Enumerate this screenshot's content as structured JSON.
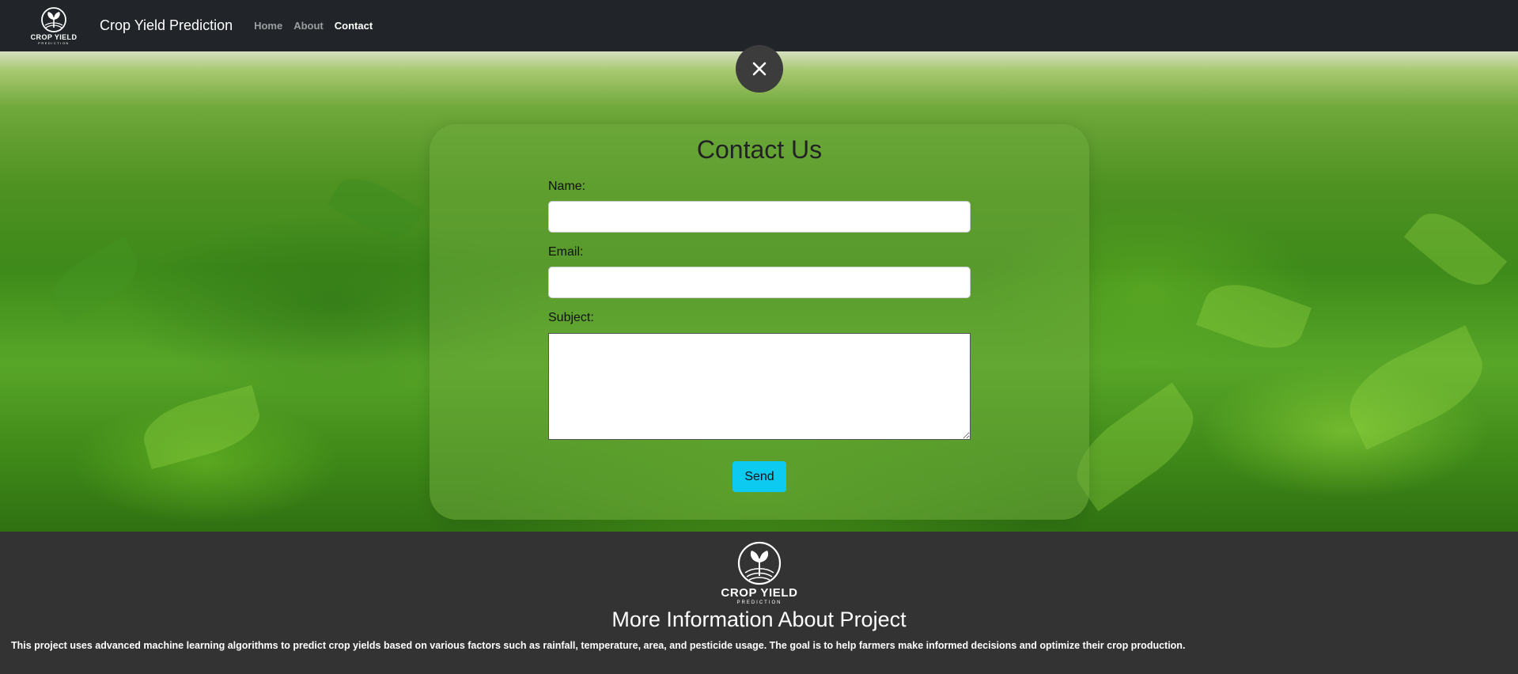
{
  "navbar": {
    "logo_text": "CROP YIELD",
    "logo_subtext": "PREDICTION",
    "brand": "Crop Yield Prediction",
    "links": [
      "Home",
      "About",
      "Contact"
    ],
    "active_link": "Contact"
  },
  "modal": {
    "title": "Contact Us",
    "name_label": "Name:",
    "name_value": "",
    "email_label": "Email:",
    "email_value": "",
    "subject_label": "Subject:",
    "subject_value": "",
    "send_label": "Send",
    "close_icon": "close-icon"
  },
  "footer": {
    "logo_text": "CROP YIELD",
    "logo_subtext": "PREDICTION",
    "title": "More Information About Project",
    "description": "This project uses advanced machine learning algorithms to predict crop yields based on various factors such as rainfall, temperature, area, and pesticide usage. The goal is to help farmers make informed decisions and optimize their crop production."
  },
  "colors": {
    "navbar_bg": "#212529",
    "footer_bg": "#333333",
    "send_button": "#0dcaf0"
  }
}
